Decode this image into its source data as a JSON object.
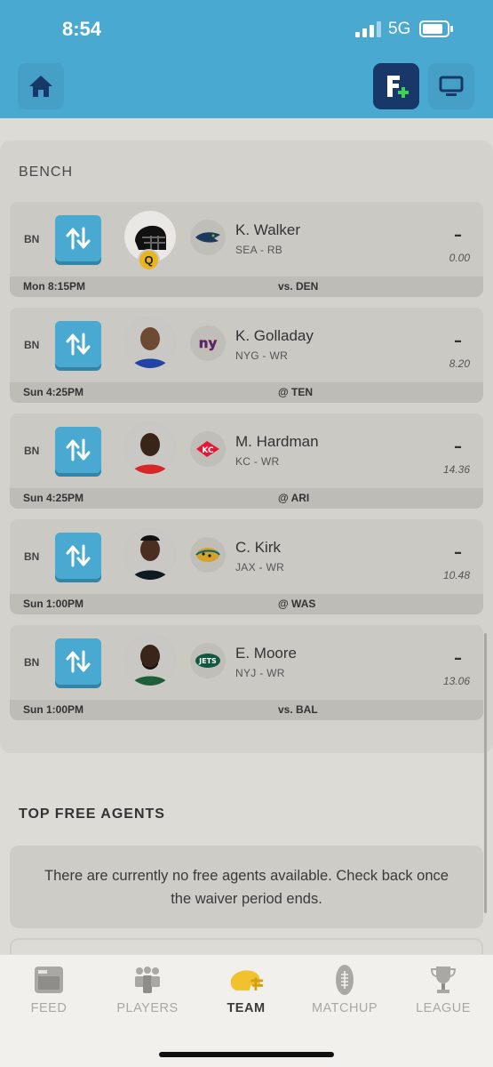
{
  "status_bar": {
    "time": "8:54",
    "network": "5G"
  },
  "header": {
    "home_icon": "home-icon",
    "fantasypros_icon": "fantasypros-add-icon",
    "tv_icon": "monitor-icon"
  },
  "bench": {
    "title": "BENCH",
    "players": [
      {
        "slot": "BN",
        "name": "K. Walker",
        "pos": "SEA - RB",
        "proj": "–",
        "points": "0.00",
        "time": "Mon 8:15PM",
        "opponent": "vs. DEN",
        "status": "Q",
        "team_logo": "seahawks-logo"
      },
      {
        "slot": "BN",
        "name": "K. Golladay",
        "pos": "NYG - WR",
        "proj": "–",
        "points": "8.20",
        "time": "Sun 4:25PM",
        "opponent": "@ TEN",
        "team_logo": "giants-logo"
      },
      {
        "slot": "BN",
        "name": "M. Hardman",
        "pos": "KC - WR",
        "proj": "–",
        "points": "14.36",
        "time": "Sun 4:25PM",
        "opponent": "@ ARI",
        "team_logo": "chiefs-logo"
      },
      {
        "slot": "BN",
        "name": "C. Kirk",
        "pos": "JAX - WR",
        "proj": "–",
        "points": "10.48",
        "time": "Sun 1:00PM",
        "opponent": "@ WAS",
        "team_logo": "jaguars-logo"
      },
      {
        "slot": "BN",
        "name": "E. Moore",
        "pos": "NYJ - WR",
        "proj": "–",
        "points": "13.06",
        "time": "Sun 1:00PM",
        "opponent": "vs. BAL",
        "team_logo": "jets-logo"
      }
    ]
  },
  "free_agents": {
    "title": "TOP FREE AGENTS",
    "message": "There are currently no free agents available. Check back once the waiver period ends."
  },
  "tabbar": {
    "tabs": [
      {
        "label": "FEED",
        "icon": "feed-icon"
      },
      {
        "label": "PLAYERS",
        "icon": "players-icon"
      },
      {
        "label": "TEAM",
        "icon": "helmet-icon",
        "active": true
      },
      {
        "label": "MATCHUP",
        "icon": "football-icon"
      },
      {
        "label": "LEAGUE",
        "icon": "trophy-icon"
      }
    ]
  },
  "colors": {
    "accent": "#4aa9d0",
    "navy": "#19386a",
    "active_tab": "#f2c12e"
  }
}
